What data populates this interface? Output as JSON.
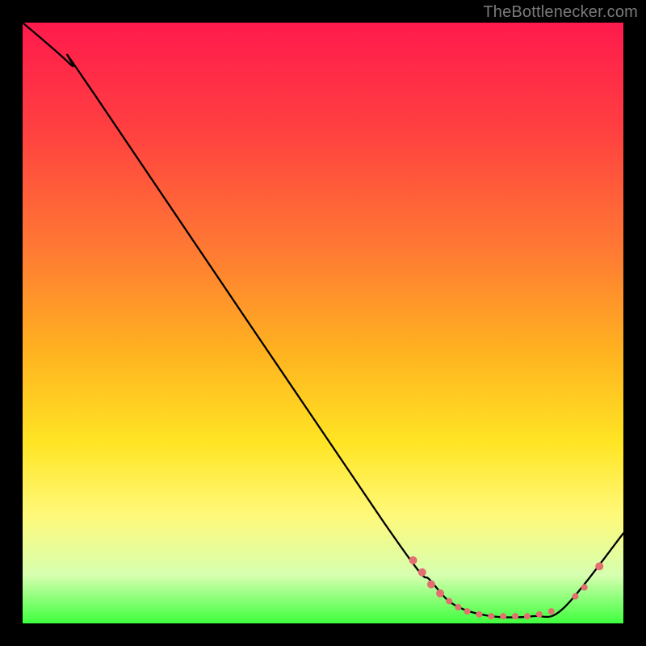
{
  "attribution": "TheBottlenecker.com",
  "chart_data": {
    "type": "line",
    "title": "",
    "xlabel": "",
    "ylabel": "",
    "xlim": [
      0,
      100
    ],
    "ylim": [
      0,
      100
    ],
    "curve": [
      {
        "x": 0,
        "y": 100
      },
      {
        "x": 8,
        "y": 93
      },
      {
        "x": 12,
        "y": 88
      },
      {
        "x": 60,
        "y": 17
      },
      {
        "x": 68,
        "y": 7
      },
      {
        "x": 72,
        "y": 3
      },
      {
        "x": 78,
        "y": 1.2
      },
      {
        "x": 85,
        "y": 1.2
      },
      {
        "x": 90,
        "y": 2.5
      },
      {
        "x": 100,
        "y": 15
      }
    ],
    "markers": [
      {
        "x": 65,
        "y": 10.5,
        "r": 5
      },
      {
        "x": 66.5,
        "y": 8.5,
        "r": 5
      },
      {
        "x": 68,
        "y": 6.5,
        "r": 5
      },
      {
        "x": 69.5,
        "y": 5,
        "r": 5
      },
      {
        "x": 71,
        "y": 3.7,
        "r": 4
      },
      {
        "x": 72.5,
        "y": 2.7,
        "r": 4
      },
      {
        "x": 74,
        "y": 2,
        "r": 4
      },
      {
        "x": 76,
        "y": 1.5,
        "r": 4
      },
      {
        "x": 78,
        "y": 1.2,
        "r": 4
      },
      {
        "x": 80,
        "y": 1.2,
        "r": 4
      },
      {
        "x": 82,
        "y": 1.2,
        "r": 4
      },
      {
        "x": 84,
        "y": 1.2,
        "r": 4
      },
      {
        "x": 86,
        "y": 1.5,
        "r": 4
      },
      {
        "x": 88,
        "y": 2,
        "r": 4
      },
      {
        "x": 92,
        "y": 4.5,
        "r": 4
      },
      {
        "x": 93.5,
        "y": 6,
        "r": 4
      },
      {
        "x": 96,
        "y": 9.5,
        "r": 5
      }
    ],
    "marker_color": "#e36f6f",
    "curve_color": "#000000"
  }
}
